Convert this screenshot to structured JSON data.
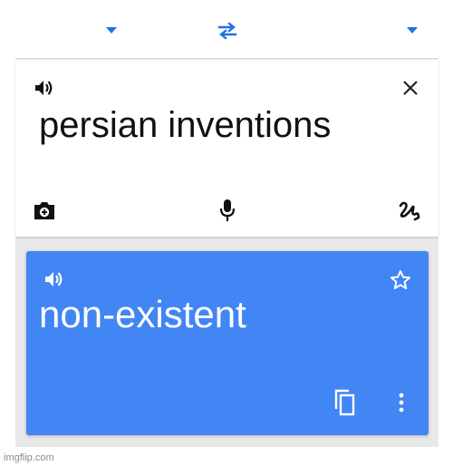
{
  "source": {
    "text": "persian inventions"
  },
  "translation": {
    "text": "non-existent"
  },
  "icons": {
    "source_lang_dropdown": "chevron-down-icon",
    "swap_languages": "swap-icon",
    "target_lang_dropdown": "chevron-down-icon",
    "listen_source": "speaker-icon",
    "clear": "close-icon",
    "camera": "camera-icon",
    "voice": "microphone-icon",
    "handwriting": "handwriting-icon",
    "listen_translation": "speaker-icon",
    "favorite": "star-icon",
    "copy": "copy-icon",
    "more": "more-vert-icon"
  },
  "colors": {
    "accent": "#4285f4",
    "dropdown": "#1a73e8",
    "background": "#e8e8e8"
  },
  "watermark": "imgflip.com"
}
